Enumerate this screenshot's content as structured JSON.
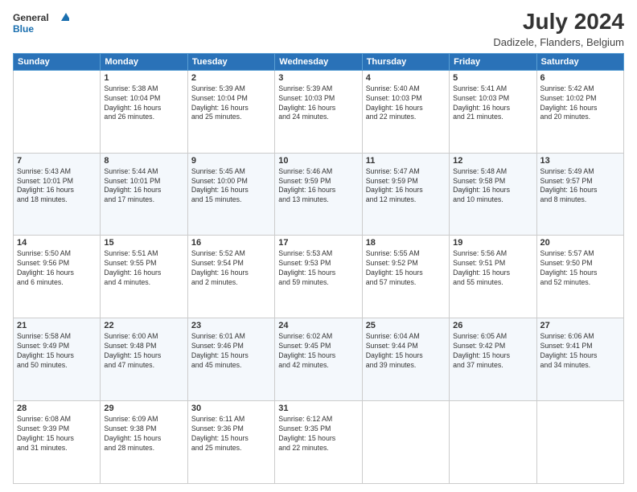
{
  "app": {
    "logo_line1": "General",
    "logo_line2": "Blue",
    "title": "July 2024",
    "subtitle": "Dadizele, Flanders, Belgium"
  },
  "calendar": {
    "headers": [
      "Sunday",
      "Monday",
      "Tuesday",
      "Wednesday",
      "Thursday",
      "Friday",
      "Saturday"
    ],
    "weeks": [
      [
        {
          "num": "",
          "info": ""
        },
        {
          "num": "1",
          "info": "Sunrise: 5:38 AM\nSunset: 10:04 PM\nDaylight: 16 hours\nand 26 minutes."
        },
        {
          "num": "2",
          "info": "Sunrise: 5:39 AM\nSunset: 10:04 PM\nDaylight: 16 hours\nand 25 minutes."
        },
        {
          "num": "3",
          "info": "Sunrise: 5:39 AM\nSunset: 10:03 PM\nDaylight: 16 hours\nand 24 minutes."
        },
        {
          "num": "4",
          "info": "Sunrise: 5:40 AM\nSunset: 10:03 PM\nDaylight: 16 hours\nand 22 minutes."
        },
        {
          "num": "5",
          "info": "Sunrise: 5:41 AM\nSunset: 10:03 PM\nDaylight: 16 hours\nand 21 minutes."
        },
        {
          "num": "6",
          "info": "Sunrise: 5:42 AM\nSunset: 10:02 PM\nDaylight: 16 hours\nand 20 minutes."
        }
      ],
      [
        {
          "num": "7",
          "info": "Sunrise: 5:43 AM\nSunset: 10:01 PM\nDaylight: 16 hours\nand 18 minutes."
        },
        {
          "num": "8",
          "info": "Sunrise: 5:44 AM\nSunset: 10:01 PM\nDaylight: 16 hours\nand 17 minutes."
        },
        {
          "num": "9",
          "info": "Sunrise: 5:45 AM\nSunset: 10:00 PM\nDaylight: 16 hours\nand 15 minutes."
        },
        {
          "num": "10",
          "info": "Sunrise: 5:46 AM\nSunset: 9:59 PM\nDaylight: 16 hours\nand 13 minutes."
        },
        {
          "num": "11",
          "info": "Sunrise: 5:47 AM\nSunset: 9:59 PM\nDaylight: 16 hours\nand 12 minutes."
        },
        {
          "num": "12",
          "info": "Sunrise: 5:48 AM\nSunset: 9:58 PM\nDaylight: 16 hours\nand 10 minutes."
        },
        {
          "num": "13",
          "info": "Sunrise: 5:49 AM\nSunset: 9:57 PM\nDaylight: 16 hours\nand 8 minutes."
        }
      ],
      [
        {
          "num": "14",
          "info": "Sunrise: 5:50 AM\nSunset: 9:56 PM\nDaylight: 16 hours\nand 6 minutes."
        },
        {
          "num": "15",
          "info": "Sunrise: 5:51 AM\nSunset: 9:55 PM\nDaylight: 16 hours\nand 4 minutes."
        },
        {
          "num": "16",
          "info": "Sunrise: 5:52 AM\nSunset: 9:54 PM\nDaylight: 16 hours\nand 2 minutes."
        },
        {
          "num": "17",
          "info": "Sunrise: 5:53 AM\nSunset: 9:53 PM\nDaylight: 15 hours\nand 59 minutes."
        },
        {
          "num": "18",
          "info": "Sunrise: 5:55 AM\nSunset: 9:52 PM\nDaylight: 15 hours\nand 57 minutes."
        },
        {
          "num": "19",
          "info": "Sunrise: 5:56 AM\nSunset: 9:51 PM\nDaylight: 15 hours\nand 55 minutes."
        },
        {
          "num": "20",
          "info": "Sunrise: 5:57 AM\nSunset: 9:50 PM\nDaylight: 15 hours\nand 52 minutes."
        }
      ],
      [
        {
          "num": "21",
          "info": "Sunrise: 5:58 AM\nSunset: 9:49 PM\nDaylight: 15 hours\nand 50 minutes."
        },
        {
          "num": "22",
          "info": "Sunrise: 6:00 AM\nSunset: 9:48 PM\nDaylight: 15 hours\nand 47 minutes."
        },
        {
          "num": "23",
          "info": "Sunrise: 6:01 AM\nSunset: 9:46 PM\nDaylight: 15 hours\nand 45 minutes."
        },
        {
          "num": "24",
          "info": "Sunrise: 6:02 AM\nSunset: 9:45 PM\nDaylight: 15 hours\nand 42 minutes."
        },
        {
          "num": "25",
          "info": "Sunrise: 6:04 AM\nSunset: 9:44 PM\nDaylight: 15 hours\nand 39 minutes."
        },
        {
          "num": "26",
          "info": "Sunrise: 6:05 AM\nSunset: 9:42 PM\nDaylight: 15 hours\nand 37 minutes."
        },
        {
          "num": "27",
          "info": "Sunrise: 6:06 AM\nSunset: 9:41 PM\nDaylight: 15 hours\nand 34 minutes."
        }
      ],
      [
        {
          "num": "28",
          "info": "Sunrise: 6:08 AM\nSunset: 9:39 PM\nDaylight: 15 hours\nand 31 minutes."
        },
        {
          "num": "29",
          "info": "Sunrise: 6:09 AM\nSunset: 9:38 PM\nDaylight: 15 hours\nand 28 minutes."
        },
        {
          "num": "30",
          "info": "Sunrise: 6:11 AM\nSunset: 9:36 PM\nDaylight: 15 hours\nand 25 minutes."
        },
        {
          "num": "31",
          "info": "Sunrise: 6:12 AM\nSunset: 9:35 PM\nDaylight: 15 hours\nand 22 minutes."
        },
        {
          "num": "",
          "info": ""
        },
        {
          "num": "",
          "info": ""
        },
        {
          "num": "",
          "info": ""
        }
      ]
    ]
  }
}
